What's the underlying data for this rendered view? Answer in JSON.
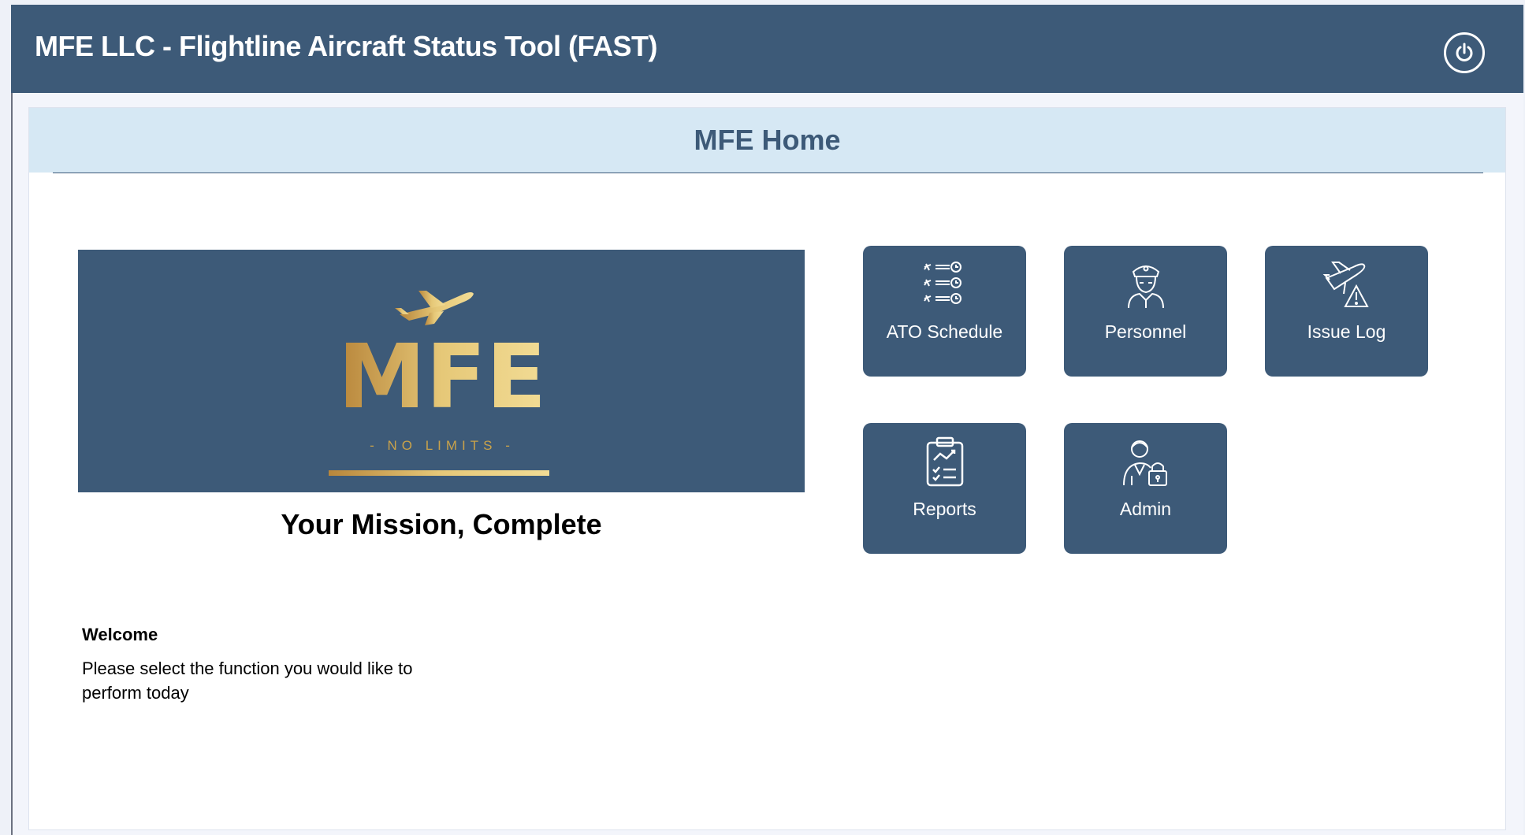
{
  "app": {
    "title": "MFE LLC - Flightline Aircraft Status Tool (FAST)",
    "power_icon": "power-icon"
  },
  "page": {
    "title": "MFE Home"
  },
  "banner": {
    "logo_text": "MFE",
    "logo_tagline": "- NO LIMITS -",
    "tagline": "Your Mission, Complete"
  },
  "welcome": {
    "heading": "Welcome",
    "message": "Please select the function you would like to perform today"
  },
  "tiles": [
    {
      "label": "ATO Schedule",
      "icon": "schedule-icon"
    },
    {
      "label": "Personnel",
      "icon": "pilot-icon"
    },
    {
      "label": "Issue Log",
      "icon": "plane-warning-icon"
    },
    {
      "label": "Reports",
      "icon": "clipboard-chart-icon"
    },
    {
      "label": "Admin",
      "icon": "admin-lock-icon"
    }
  ],
  "colors": {
    "primary": "#3d5a78",
    "header_bg": "#d6e8f4",
    "gold": "#c9a24a"
  }
}
